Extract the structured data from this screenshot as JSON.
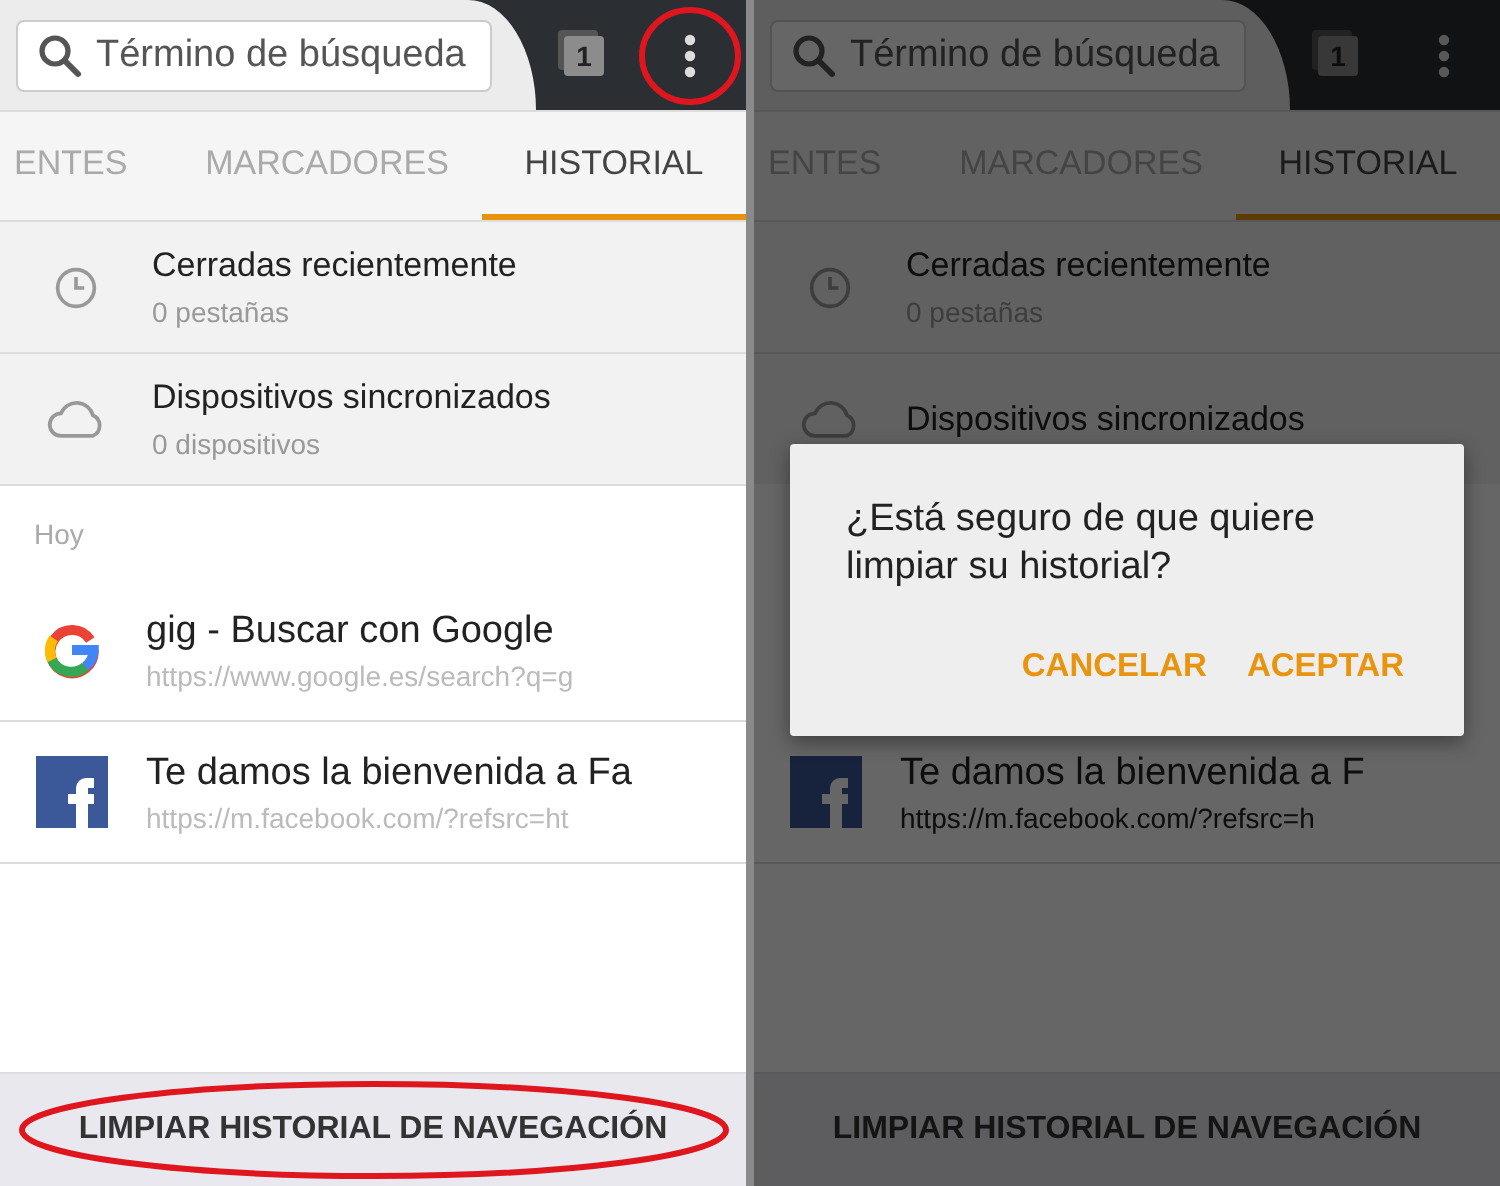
{
  "panels": [
    {
      "search": {
        "placeholder": "Término de búsqueda"
      },
      "tab_count": "1",
      "menu_highlighted": true,
      "tabs": [
        {
          "label": "ENTES",
          "selected": false
        },
        {
          "label": "MARCADORES",
          "selected": false
        },
        {
          "label": "HISTORIAL",
          "selected": true
        }
      ],
      "sections": [
        {
          "kind": "clock",
          "title": "Cerradas recientemente",
          "subtitle": "0 pestañas"
        },
        {
          "kind": "cloud",
          "title": "Dispositivos sincronizados",
          "subtitle": "0 dispositivos"
        }
      ],
      "day_label": "Hoy",
      "history": [
        {
          "kind": "google",
          "title": "gig - Buscar con Google",
          "url": "https://www.google.es/search?q=g"
        },
        {
          "kind": "facebook",
          "title": "Te damos la bienvenida a Fa",
          "url": "https://m.facebook.com/?refsrc=ht"
        }
      ],
      "clear_button": {
        "label": "LIMPIAR HISTORIAL DE NAVEGACIÓN",
        "highlighted": true
      }
    },
    {
      "search": {
        "placeholder": "Término de búsqueda"
      },
      "tab_count": "1",
      "menu_highlighted": false,
      "tabs": [
        {
          "label": "ENTES",
          "selected": false
        },
        {
          "label": "MARCADORES",
          "selected": false
        },
        {
          "label": "HISTORIAL",
          "selected": true
        }
      ],
      "sections": [
        {
          "kind": "clock",
          "title": "Cerradas recientemente",
          "subtitle": "0 pestañas"
        },
        {
          "kind": "cloud",
          "title": "Dispositivos sincronizados"
        }
      ],
      "history": [
        {
          "kind": "facebook",
          "title": "Te damos la bienvenida a F",
          "url": "https://m.facebook.com/?refsrc=h"
        }
      ],
      "clear_button": {
        "label": "LIMPIAR HISTORIAL DE NAVEGACIÓN",
        "highlighted": false
      },
      "dialog": {
        "message": "¿Está seguro de que quiere limpiar su historial?",
        "buttons": [
          "CANCELAR",
          "ACEPTAR"
        ]
      }
    }
  ]
}
